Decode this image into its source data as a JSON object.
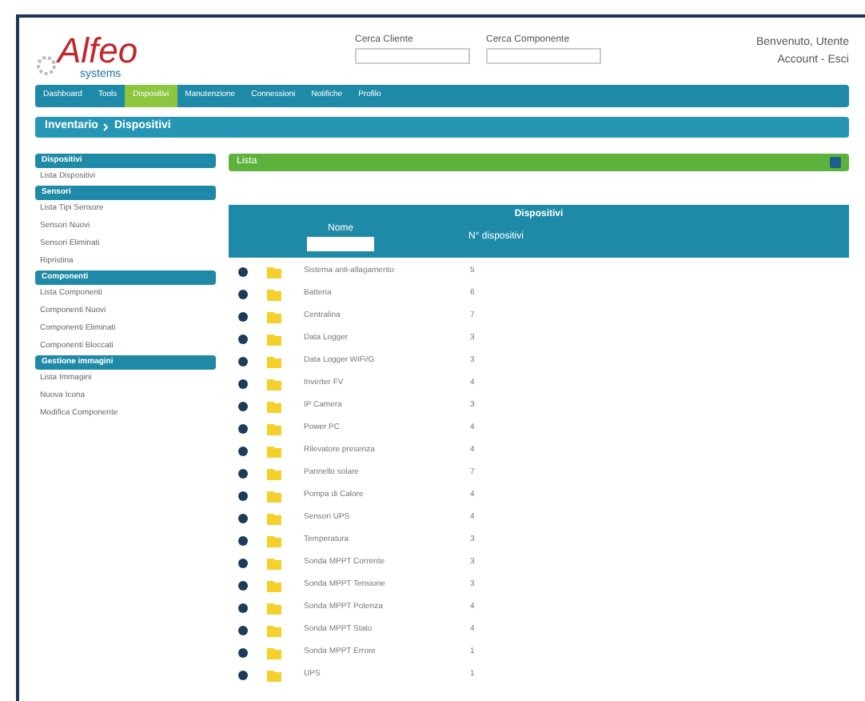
{
  "header": {
    "logo": "Alfeo",
    "logo_sub": "systems",
    "search_fields": [
      {
        "label": "Cerca Cliente"
      },
      {
        "label": "Cerca Componente"
      }
    ],
    "user": "Benvenuto, Utente",
    "account": "Account - Esci"
  },
  "nav": [
    {
      "label": "Dashboard",
      "selected": false
    },
    {
      "label": "Tools",
      "selected": false
    },
    {
      "label": "Dispositivi",
      "selected": true
    },
    {
      "label": "Manutenzione",
      "selected": false
    },
    {
      "label": "Connessioni",
      "selected": false
    },
    {
      "label": "Notifiche",
      "selected": false
    },
    {
      "label": "Profilo",
      "selected": false
    }
  ],
  "breadcrumb": [
    "Inventario",
    "Dispositivi"
  ],
  "sidebar": [
    {
      "title": "Dispositivi",
      "items": [
        "Lista Dispositivi"
      ]
    },
    {
      "title": "Sensori",
      "items": [
        "Lista Tipi Sensore",
        "Sensori Nuovi",
        "Sensori Eliminati",
        "Ripristina"
      ]
    },
    {
      "title": "Componenti",
      "items": [
        "Lista Componenti",
        "Componenti Nuovi",
        "Componenti Eliminati",
        "Componenti Bloccati"
      ]
    },
    {
      "title": "Gestione immagini",
      "items": [
        "Lista Immagini",
        "Nuova Icona",
        "Modifica Componente"
      ]
    }
  ],
  "panel": {
    "title": "Lista"
  },
  "table": {
    "title": "Dispositivi",
    "columns": [
      "Nome",
      "N° dispositivi"
    ],
    "rows": [
      {
        "name": "Sistema anti-allagamento",
        "count": "5"
      },
      {
        "name": "Batteria",
        "count": "6"
      },
      {
        "name": "Centralina",
        "count": "7"
      },
      {
        "name": "Data Logger",
        "count": "3"
      },
      {
        "name": "Data Logger WiFi/G",
        "count": "3"
      },
      {
        "name": "Inverter FV",
        "count": "4"
      },
      {
        "name": "IP Camera",
        "count": "3"
      },
      {
        "name": "Power PC",
        "count": "4"
      },
      {
        "name": "Rilevatore presenza",
        "count": "4"
      },
      {
        "name": "Pannello solare",
        "count": "7"
      },
      {
        "name": "Pompa di Calore",
        "count": "4"
      },
      {
        "name": "Sensori UPS",
        "count": "4"
      },
      {
        "name": "Temperatura",
        "count": "3"
      },
      {
        "name": "Sonda MPPT Corrente",
        "count": "3"
      },
      {
        "name": "Sonda MPPT Tensione",
        "count": "3"
      },
      {
        "name": "Sonda MPPT Potenza",
        "count": "4"
      },
      {
        "name": "Sonda MPPT Stato",
        "count": "4"
      },
      {
        "name": "Sonda MPPT Errore",
        "count": "1"
      },
      {
        "name": "UPS",
        "count": "1"
      }
    ]
  }
}
